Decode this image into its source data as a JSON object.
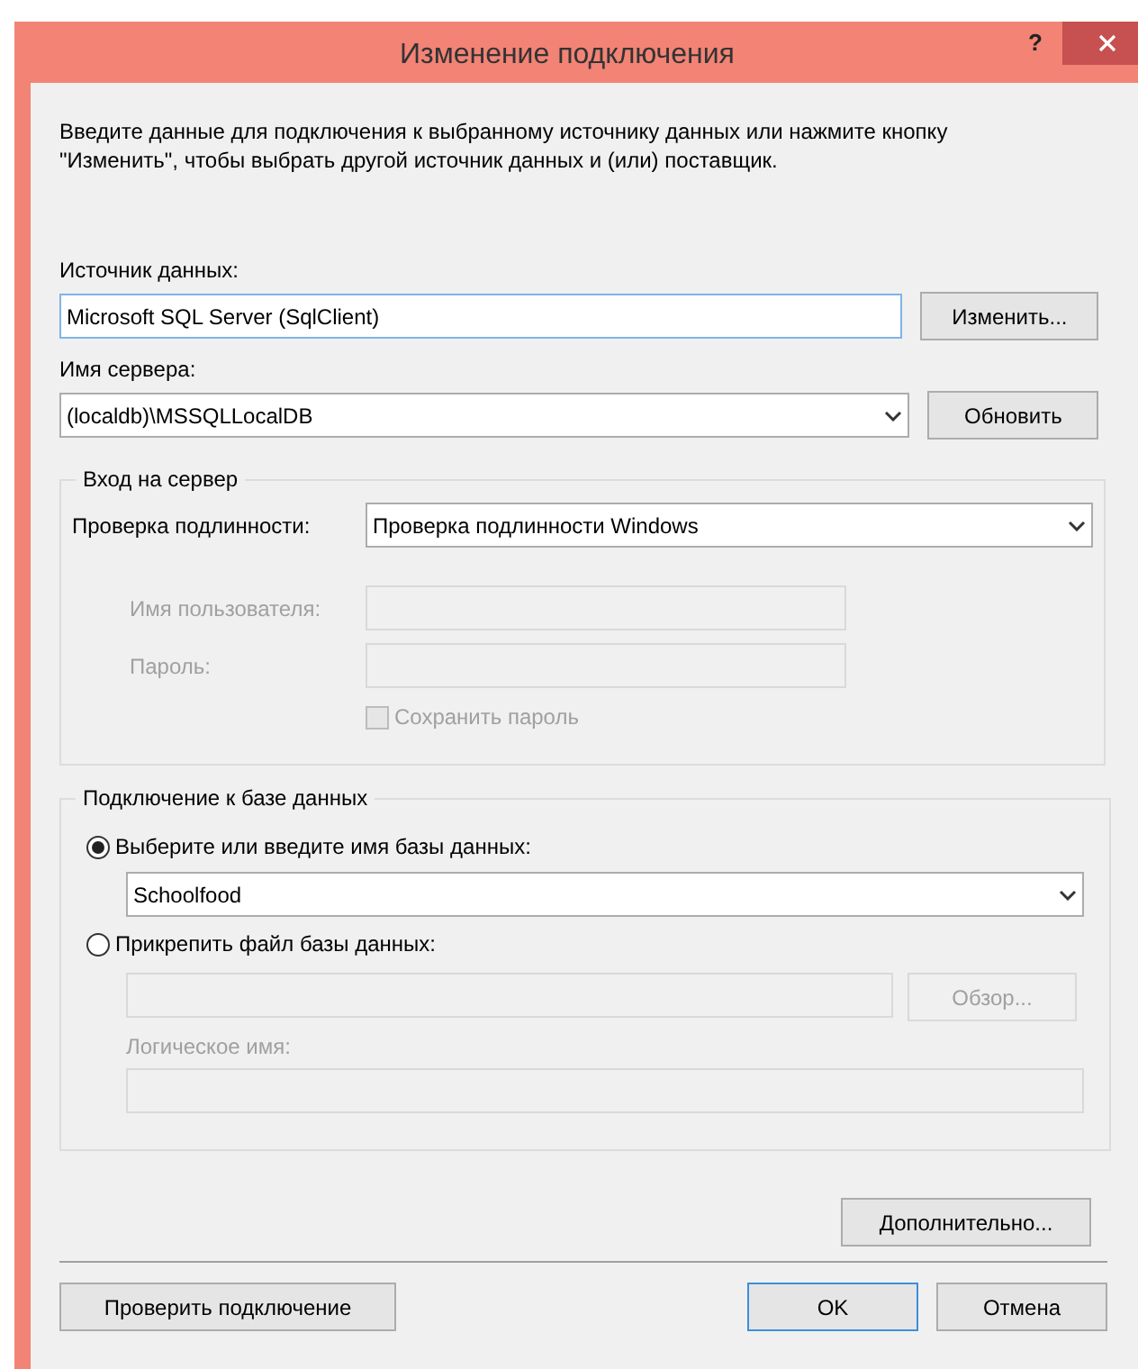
{
  "window": {
    "title": "Изменение подключения",
    "help": "?"
  },
  "description": "Введите данные для подключения к выбранному источнику данных или нажмите кнопку \"Изменить\", чтобы выбрать другой источник данных и (или) поставщик.",
  "data_source": {
    "label": "Источник данных:",
    "value": "Microsoft SQL Server (SqlClient)",
    "button": "Изменить..."
  },
  "server": {
    "label": "Имя сервера:",
    "value": "(localdb)\\MSSQLLocalDB",
    "button": "Обновить"
  },
  "login_group": {
    "title": "Вход на сервер",
    "auth_label": "Проверка подлинности:",
    "auth_value": "Проверка подлинности Windows",
    "fields": [
      {
        "label": "Имя пользователя:",
        "disabled": true
      },
      {
        "label": "Пароль:",
        "disabled": true
      }
    ],
    "save_password": {
      "label": "Сохранить пароль",
      "checked": false,
      "disabled": true
    }
  },
  "db_group": {
    "title": "Подключение к базе данных",
    "options": [
      {
        "kind": "combo",
        "label": "Выберите или введите имя базы данных:",
        "selected": true,
        "value": "Schoolfood"
      },
      {
        "kind": "file",
        "label": "Прикрепить файл базы данных:",
        "selected": false,
        "browse": "Обзор...",
        "logical_label": "Логическое имя:",
        "disabled": true
      }
    ]
  },
  "advanced_button": "Дополнительно...",
  "footer": {
    "test_button": "Проверить подключение",
    "ok": "OK",
    "cancel": "Отмена"
  }
}
